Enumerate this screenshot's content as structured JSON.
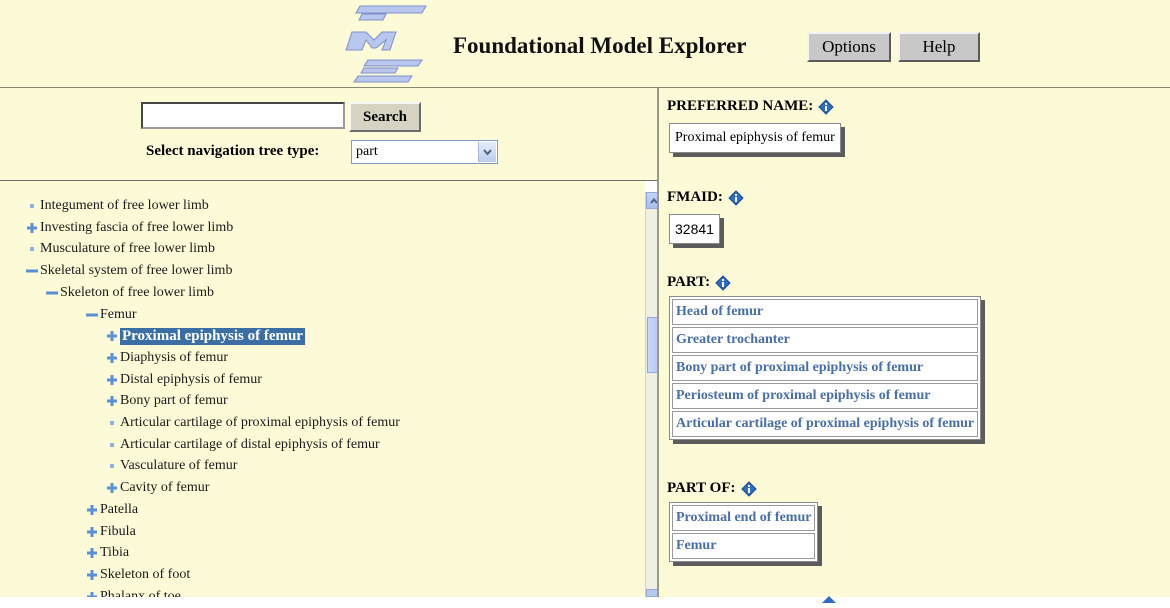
{
  "header": {
    "title": "Foundational Model Explorer",
    "options_label": "Options",
    "help_label": "Help"
  },
  "search": {
    "button_label": "Search",
    "value": ""
  },
  "nav_tree_type": {
    "label": "Select navigation tree type:",
    "selected": "part"
  },
  "tree": [
    {
      "label": "Integument of free lower limb",
      "icon": "bullet",
      "level": 0
    },
    {
      "label": "Investing fascia of free lower limb",
      "icon": "plus",
      "level": 0
    },
    {
      "label": "Musculature of free lower limb",
      "icon": "bullet",
      "level": 0
    },
    {
      "label": "Skeletal system of free lower limb",
      "icon": "minus",
      "level": 0
    },
    {
      "label": "Skeleton of free lower limb",
      "icon": "minus",
      "level": 1
    },
    {
      "label": "Femur",
      "icon": "minus",
      "level": 2
    },
    {
      "label": "Proximal epiphysis of femur",
      "icon": "plus",
      "level": 3,
      "selected": true
    },
    {
      "label": "Diaphysis of femur",
      "icon": "plus",
      "level": 3
    },
    {
      "label": "Distal epiphysis of femur",
      "icon": "plus",
      "level": 3
    },
    {
      "label": "Bony part of femur",
      "icon": "plus",
      "level": 3
    },
    {
      "label": "Articular cartilage of proximal epiphysis of femur",
      "icon": "bullet",
      "level": 3
    },
    {
      "label": "Articular cartilage of distal epiphysis of femur",
      "icon": "bullet",
      "level": 3
    },
    {
      "label": "Vasculature of femur",
      "icon": "bullet",
      "level": 3
    },
    {
      "label": "Cavity of femur",
      "icon": "plus",
      "level": 3
    },
    {
      "label": "Patella",
      "icon": "plus",
      "level": 2
    },
    {
      "label": "Fibula",
      "icon": "plus",
      "level": 2
    },
    {
      "label": "Tibia",
      "icon": "plus",
      "level": 2
    },
    {
      "label": "Skeleton of foot",
      "icon": "plus",
      "level": 2
    },
    {
      "label": "Phalanx of toe",
      "icon": "plus",
      "level": 2
    }
  ],
  "details": {
    "preferred_name": {
      "heading": "PREFERRED NAME:",
      "value": "Proximal epiphysis of femur"
    },
    "fmaid": {
      "heading": "FMAID:",
      "value": "32841"
    },
    "part": {
      "heading": "PART:",
      "items": [
        "Head of femur",
        "Greater trochanter",
        "Bony part of proximal epiphysis of femur",
        "Periosteum of proximal epiphysis of femur",
        "Articular cartilage of proximal epiphysis of femur"
      ]
    },
    "part_of": {
      "heading": "PART OF:",
      "items": [
        "Proximal end of femur",
        "Femur"
      ]
    }
  },
  "colors": {
    "panel_bg": "#fdfbd7",
    "link": "#4a6fa5",
    "selection": "#3a6ea5",
    "tree_plus": "#5b8fd6"
  }
}
